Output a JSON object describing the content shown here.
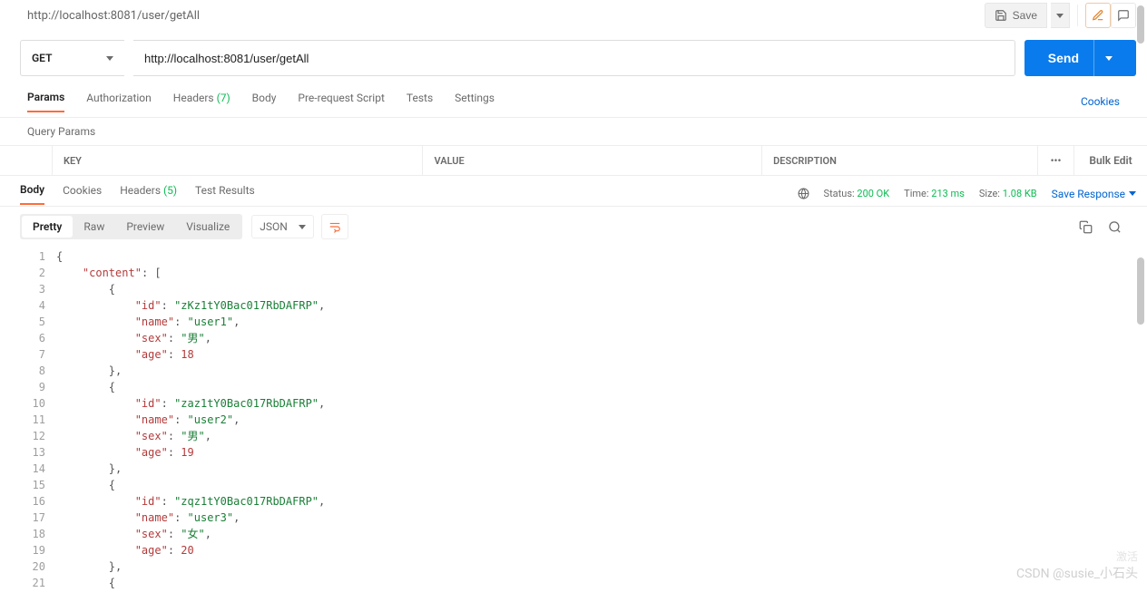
{
  "header": {
    "title": "http://localhost:8081/user/getAll",
    "save_label": "Save"
  },
  "request": {
    "method": "GET",
    "url": "http://localhost:8081/user/getAll",
    "send_label": "Send"
  },
  "req_tabs": {
    "params": "Params",
    "auth": "Authorization",
    "headers_label": "Headers",
    "headers_count": "(7)",
    "body": "Body",
    "prereq": "Pre-request Script",
    "tests": "Tests",
    "settings": "Settings",
    "cookies": "Cookies"
  },
  "params_section": {
    "title": "Query Params",
    "columns": {
      "key": "KEY",
      "value": "VALUE",
      "desc": "DESCRIPTION",
      "bulk": "Bulk Edit"
    }
  },
  "resp_tabs": {
    "body": "Body",
    "cookies": "Cookies",
    "headers_label": "Headers",
    "headers_count": "(5)",
    "tests": "Test Results"
  },
  "resp_meta": {
    "status_label": "Status:",
    "status_value": "200 OK",
    "time_label": "Time:",
    "time_value": "213 ms",
    "size_label": "Size:",
    "size_value": "1.08 KB",
    "save_response": "Save Response"
  },
  "resp_toolbar": {
    "pretty": "Pretty",
    "raw": "Raw",
    "preview": "Preview",
    "visualize": "Visualize",
    "format": "JSON"
  },
  "code": {
    "lines": [
      "{",
      "    \"content\": [",
      "        {",
      "            \"id\": \"zKz1tY0Bac017RbDAFRP\",",
      "            \"name\": \"user1\",",
      "            \"sex\": \"男\",",
      "            \"age\": 18",
      "        },",
      "        {",
      "            \"id\": \"zaz1tY0Bac017RbDAFRP\",",
      "            \"name\": \"user2\",",
      "            \"sex\": \"男\",",
      "            \"age\": 19",
      "        },",
      "        {",
      "            \"id\": \"zqz1tY0Bac017RbDAFRP\",",
      "            \"name\": \"user3\",",
      "            \"sex\": \"女\",",
      "            \"age\": 20",
      "        },",
      "        {"
    ]
  },
  "watermark": {
    "line1": "激活",
    "line2": "CSDN @susie_小石头"
  }
}
